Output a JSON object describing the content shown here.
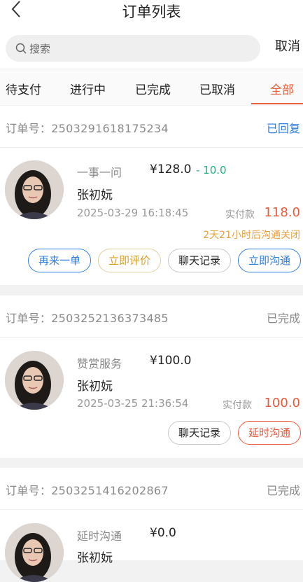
{
  "header": {
    "title": "订单列表"
  },
  "search": {
    "placeholder": "搜索",
    "cancel_label": "取消"
  },
  "tabs": [
    {
      "label": "待支付",
      "active": false
    },
    {
      "label": "进行中",
      "active": false
    },
    {
      "label": "已完成",
      "active": false
    },
    {
      "label": "已取消",
      "active": false
    },
    {
      "label": "全部",
      "active": true
    }
  ],
  "orders": [
    {
      "order_label": "订单号：",
      "order_no": "2503291618175234",
      "status": "已回复",
      "service": "一事一问",
      "price": "¥128.0",
      "discount": "- 10.0",
      "person": "张初妧",
      "time": "2025-03-29 16:18:45",
      "paid_label": "实付款",
      "paid_amount": "118.0",
      "countdown": "2天21小时后沟通关闭",
      "buttons": [
        "再来一单",
        "立即评价",
        "聊天记录",
        "立即沟通"
      ]
    },
    {
      "order_label": "订单号：",
      "order_no": "2503252136373485",
      "status": "已完成",
      "service": "赞赏服务",
      "price": "¥100.0",
      "person": "张初妧",
      "time": "2025-03-25 21:36:54",
      "paid_label": "实付款",
      "paid_amount": "100.0",
      "buttons": [
        "聊天记录",
        "延时沟通"
      ]
    },
    {
      "order_label": "订单号：",
      "order_no": "2503251416202867",
      "status": "已完成",
      "service": "延时沟通",
      "price": "¥0.0",
      "person": "张初妧"
    }
  ],
  "colors": {
    "accent": "#e8603c",
    "blue": "#2f7fe0",
    "green": "#21b080",
    "gold": "#d8a020",
    "price_red": "#e85a3c"
  },
  "icons": {
    "back": "chevron-left-icon",
    "search": "search-icon"
  }
}
